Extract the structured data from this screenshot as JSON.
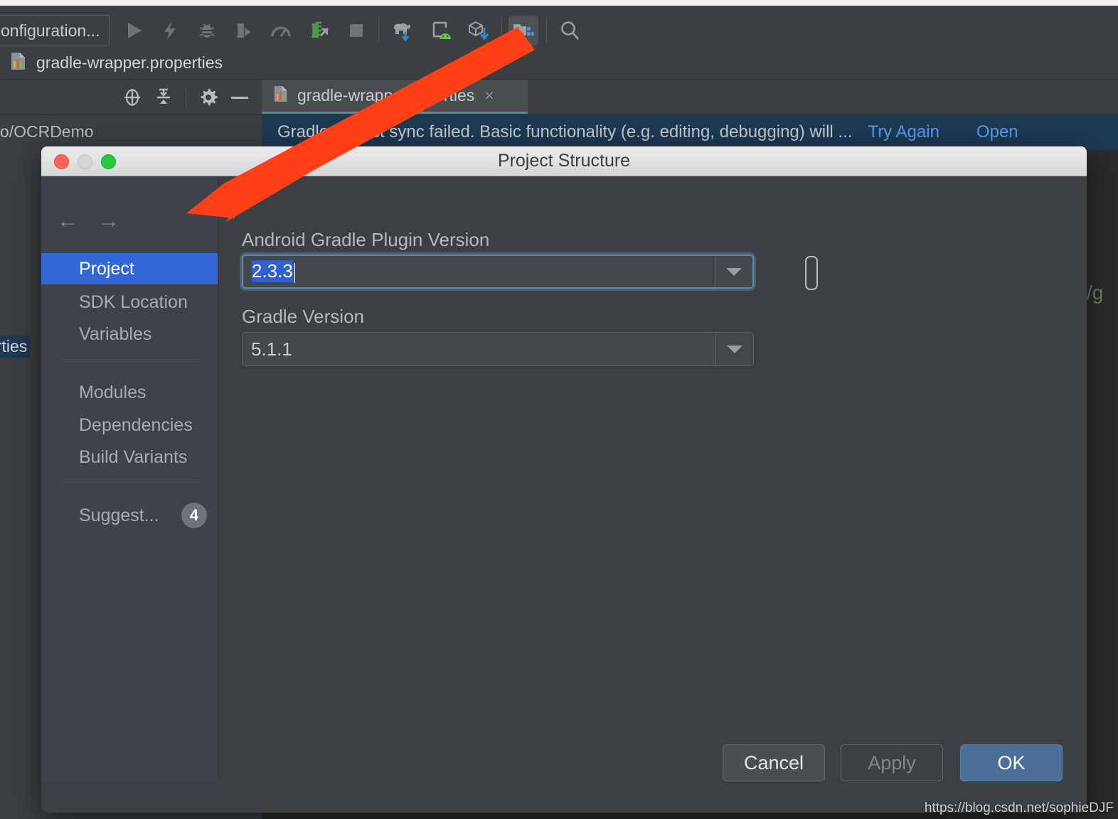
{
  "ide": {
    "run_configuration_chip": "onfiguration...",
    "toolbar_icons": [
      {
        "name": "run-icon",
        "glyph": "play"
      },
      {
        "name": "apply-changes-icon",
        "glyph": "bolt"
      },
      {
        "name": "debug-icon",
        "glyph": "bug"
      },
      {
        "name": "attach-debugger-icon",
        "glyph": "attach"
      },
      {
        "name": "profiler-icon",
        "glyph": "gauge"
      },
      {
        "name": "sync-project-icon",
        "glyph": "gradle-sync"
      },
      {
        "name": "stop-icon",
        "glyph": "stop"
      },
      {
        "name": "gradle-elephant-icon",
        "glyph": "elephant"
      },
      {
        "name": "avd-manager-icon",
        "glyph": "android-device"
      },
      {
        "name": "sdk-manager-icon",
        "glyph": "cube-down"
      },
      {
        "name": "project-structure-icon",
        "glyph": "project-structure"
      },
      {
        "name": "search-everywhere-icon",
        "glyph": "magnifier"
      }
    ],
    "breadcrumb_file": "gradle-wrapper.properties",
    "pane_icons": [
      {
        "name": "locate-icon",
        "glyph": "target"
      },
      {
        "name": "collapse-all-icon",
        "glyph": "collapse"
      },
      {
        "name": "settings-gear-icon",
        "glyph": "gear"
      },
      {
        "name": "hide-pane-icon",
        "glyph": "minus"
      }
    ],
    "editor_tab": {
      "label": "gradle-wrapp   .properties",
      "close": "×"
    },
    "tree_rows": [
      {
        "label": "dio/OCRDemo"
      },
      {
        "label": "erties"
      }
    ],
    "banner": {
      "message": "Gradle project sync failed. Basic functionality (e.g. editing, debugging) will ...",
      "link_try_again": "Try Again",
      "link_open": "Open"
    },
    "code_fragment": "/g"
  },
  "dialog": {
    "title": "Project Structure",
    "traffic_lights": [
      {
        "name": "close-window-button",
        "color": "#ff6159"
      },
      {
        "name": "minimize-window-button",
        "color": "#d5d5d5"
      },
      {
        "name": "maximize-window-button",
        "color": "#28c93f"
      }
    ],
    "nav": {
      "back": "←",
      "forward": "→"
    },
    "sidebar": {
      "items": [
        {
          "label": "Project",
          "selected": true
        },
        {
          "label": "SDK Location",
          "selected": false
        },
        {
          "label": "Variables",
          "selected": false
        },
        {
          "label": "Modules",
          "selected": false
        },
        {
          "label": "Dependencies",
          "selected": false
        },
        {
          "label": "Build Variants",
          "selected": false
        },
        {
          "label": "Suggest...",
          "selected": false,
          "badge": "4"
        }
      ]
    },
    "fields": [
      {
        "label": "Android Gradle Plugin Version",
        "value": "2.3.3",
        "focused": true,
        "selected": true
      },
      {
        "label": "Gradle Version",
        "value": "5.1.1",
        "focused": false,
        "selected": false
      }
    ],
    "buttons": {
      "cancel": "Cancel",
      "apply": "Apply",
      "ok": "OK"
    }
  },
  "watermark": "https://blog.csdn.net/sophieDJF",
  "colors": {
    "accent_selected": "#3367d6",
    "ok_button": "#4b6f99",
    "banner_bg": "#1d3a55",
    "link": "#5a9bf0",
    "annotation_arrow": "#ff4016"
  }
}
